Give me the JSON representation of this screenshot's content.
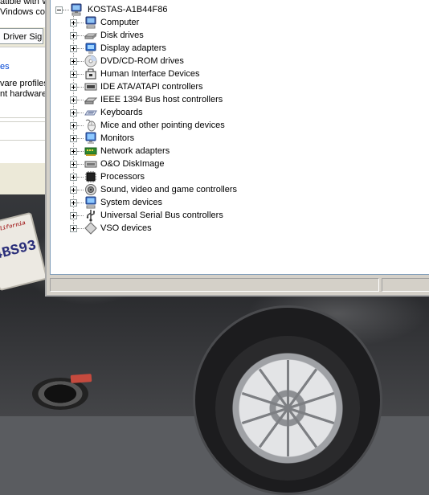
{
  "left_window": {
    "line1": "atible with W",
    "line2": "Vindows co",
    "tab_label": "Driver Sign",
    "link_fragment": "es",
    "profiles_fragment": "vare profiles",
    "hardware_fragment": "nt hardware"
  },
  "device_manager": {
    "root": {
      "label": "KOSTAS-A1B44F86",
      "icon": "computer-icon"
    },
    "categories": [
      {
        "label": "Computer",
        "icon": "computer-icon"
      },
      {
        "label": "Disk drives",
        "icon": "disk-drive-icon"
      },
      {
        "label": "Display adapters",
        "icon": "display-adapter-icon"
      },
      {
        "label": "DVD/CD-ROM drives",
        "icon": "cdrom-icon"
      },
      {
        "label": "Human Interface Devices",
        "icon": "hid-icon"
      },
      {
        "label": "IDE ATA/ATAPI controllers",
        "icon": "ide-controller-icon"
      },
      {
        "label": "IEEE 1394 Bus host controllers",
        "icon": "firewire-icon"
      },
      {
        "label": "Keyboards",
        "icon": "keyboard-icon"
      },
      {
        "label": "Mice and other pointing devices",
        "icon": "mouse-icon"
      },
      {
        "label": "Monitors",
        "icon": "monitor-icon"
      },
      {
        "label": "Network adapters",
        "icon": "network-adapter-icon"
      },
      {
        "label": "O&O DiskImage",
        "icon": "diskimage-icon"
      },
      {
        "label": "Processors",
        "icon": "processor-icon"
      },
      {
        "label": "Sound, video and game controllers",
        "icon": "sound-icon"
      },
      {
        "label": "System devices",
        "icon": "system-devices-icon"
      },
      {
        "label": "Universal Serial Bus controllers",
        "icon": "usb-icon"
      },
      {
        "label": "VSO devices",
        "icon": "vso-device-icon"
      }
    ]
  },
  "background_photo": {
    "plate_state": "California",
    "plate_text": "4BS93"
  }
}
